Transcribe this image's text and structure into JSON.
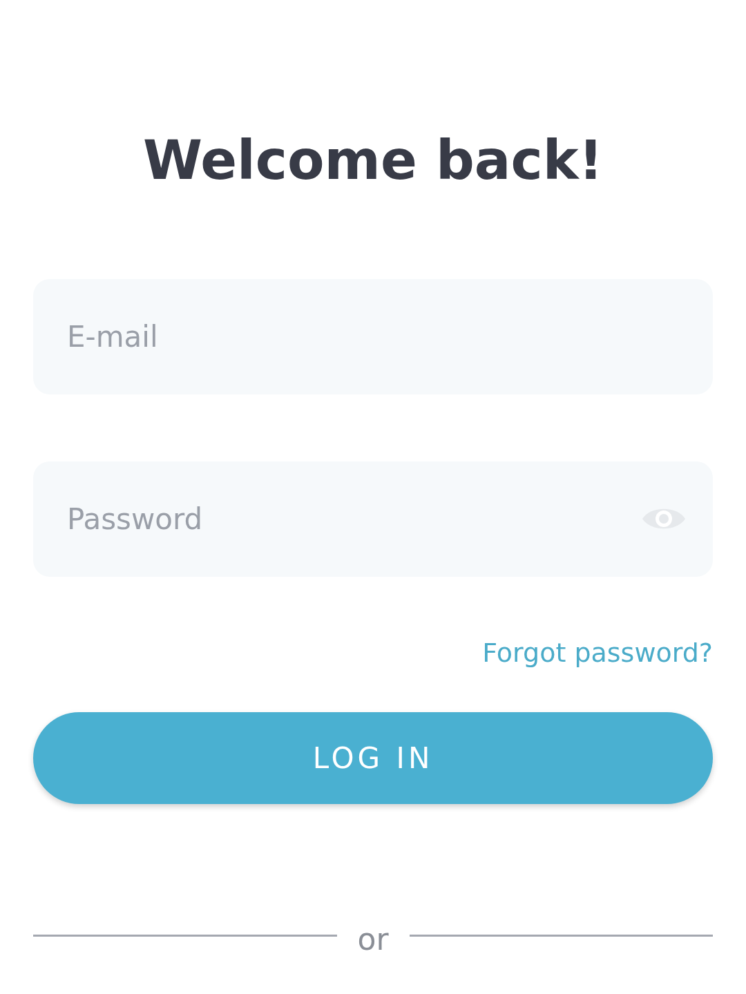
{
  "title": "Welcome back!",
  "fields": [
    {
      "kind": "email",
      "placeholder": "E-mail"
    },
    {
      "kind": "password",
      "placeholder": "Password"
    }
  ],
  "forgot_link": "Forgot password?",
  "login_button": "LOG IN",
  "divider": "or"
}
